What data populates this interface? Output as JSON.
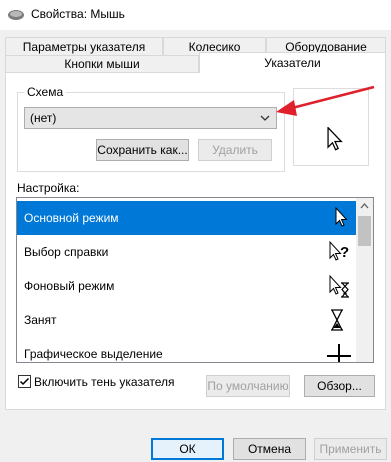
{
  "window": {
    "title": "Свойства: Мышь"
  },
  "tabs_back": [
    "Параметры указателя",
    "Колесико",
    "Оборудование"
  ],
  "tabs_front": [
    "Кнопки мыши",
    "Указатели"
  ],
  "scheme": {
    "group_label": "Схема",
    "selected": "(нет)",
    "save_as_label": "Сохранить как...",
    "delete_label": "Удалить"
  },
  "customize": {
    "label": "Настройка:",
    "items": [
      {
        "label": "Основной режим",
        "cursor": "arrow-cursor-icon",
        "selected": true
      },
      {
        "label": "Выбор справки",
        "cursor": "help-cursor-icon",
        "selected": false
      },
      {
        "label": "Фоновый режим",
        "cursor": "working-cursor-icon",
        "selected": false
      },
      {
        "label": "Занят",
        "cursor": "hourglass-cursor-icon",
        "selected": false
      },
      {
        "label": "Графическое выделение",
        "cursor": "crosshair-cursor-icon",
        "selected": false
      }
    ]
  },
  "shadow": {
    "label": "Включить тень указателя",
    "checked": true
  },
  "default_label": "По умолчанию",
  "browse_label": "Обзор...",
  "footer": {
    "ok_label": "ОК",
    "cancel_label": "Отмена",
    "apply_label": "Применить"
  },
  "colors": {
    "accent": "#0078d7",
    "annotation_arrow": "#e0202a"
  }
}
